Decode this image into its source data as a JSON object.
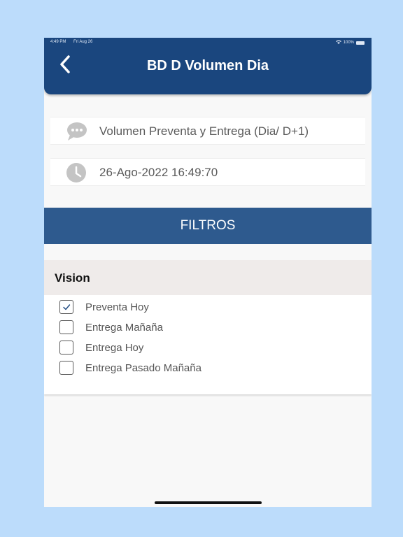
{
  "status_bar": {
    "time": "4:49 PM",
    "date": "Fri Aug 26",
    "battery": "100%"
  },
  "header": {
    "title": "BD D Volumen Dia",
    "back_icon": "chevron-left-icon"
  },
  "report": {
    "name": "Volumen Preventa y Entrega (Dia/ D+1)",
    "name_icon": "chat-bubble-icon",
    "timestamp": "26-Ago-2022 16:49:70",
    "timestamp_icon": "clock-icon"
  },
  "filters": {
    "label": "FILTROS"
  },
  "vision": {
    "title": "Vision",
    "options": [
      {
        "label": "Preventa Hoy",
        "checked": true
      },
      {
        "label": "Entrega Mañaña",
        "checked": false
      },
      {
        "label": "Entrega Hoy",
        "checked": false
      },
      {
        "label": "Entrega Pasado Mañaña",
        "checked": false
      }
    ]
  },
  "colors": {
    "page_bg": "#bcdcfb",
    "header": "#1a467e",
    "filters_bar": "#2e5a8e",
    "card_head": "#efebea",
    "check": "#1a467e"
  }
}
